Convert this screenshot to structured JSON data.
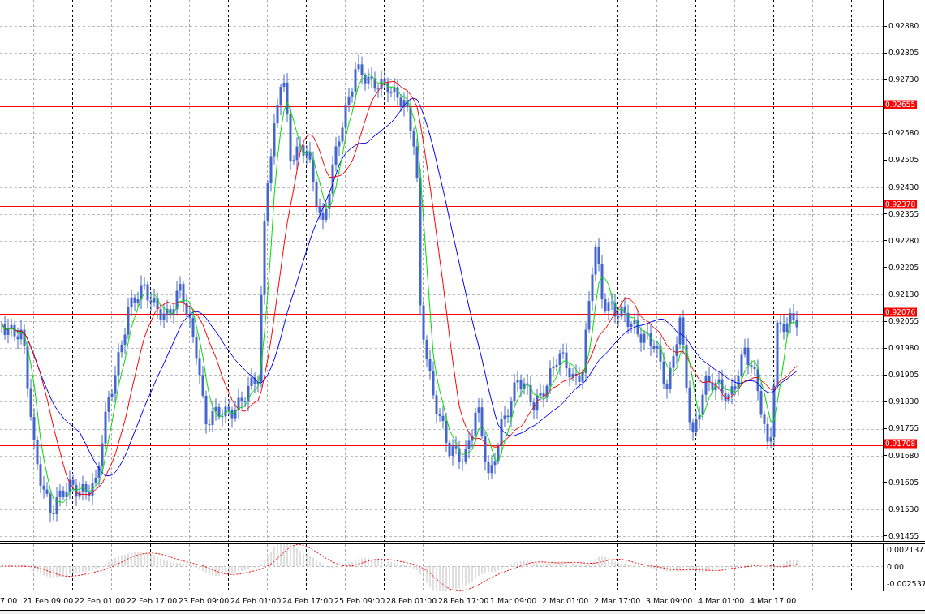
{
  "price_axis": {
    "ticks": [
      "0.92880",
      "0.92805",
      "0.92730",
      "0.92580",
      "0.92505",
      "0.92430",
      "0.92355",
      "0.92280",
      "0.92205",
      "0.92130",
      "0.92055",
      "0.91980",
      "0.91905",
      "0.91830",
      "0.91755",
      "0.91680",
      "0.91605",
      "0.91530",
      "0.91455"
    ]
  },
  "levels": [
    {
      "price": "0.92655"
    },
    {
      "price": "0.92378"
    },
    {
      "price": "0.92076"
    },
    {
      "price": "0.91708"
    }
  ],
  "indicator_axis": {
    "ticks": [
      "0.002137",
      "0.00",
      "-0.002537"
    ]
  },
  "time_axis": {
    "first_label": "7:00",
    "labels": [
      "21 Feb 09:00",
      "22 Feb 01:00",
      "22 Feb 17:00",
      "23 Feb 09:00",
      "24 Feb 01:00",
      "24 Feb 17:00",
      "25 Feb 09:00",
      "28 Feb 01:00",
      "28 Feb 17:00",
      "1 Mar 09:00",
      "2 Mar 01:00",
      "2 Mar 17:00",
      "3 Mar 09:00",
      "4 Mar 01:00",
      "4 Mar 17:00"
    ]
  }
}
